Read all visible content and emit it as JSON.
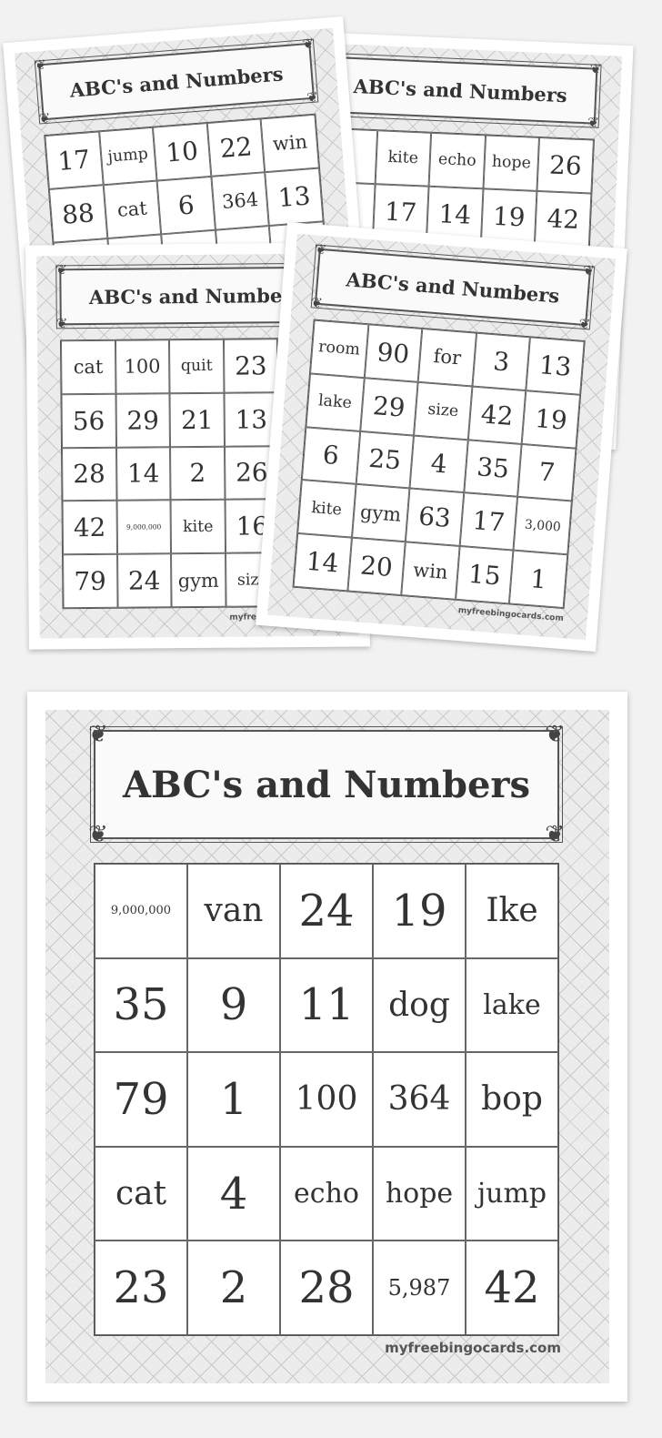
{
  "cards": [
    {
      "id": "card-b",
      "title": "ABC's and Numbers",
      "footer": "myfreebingocards.com",
      "cells": [
        null,
        "kite",
        "echo",
        "hope",
        "26",
        null,
        "17",
        "14",
        "19",
        "42",
        null,
        null,
        null,
        null,
        null,
        null,
        null,
        null,
        null,
        null,
        null,
        null,
        null,
        null,
        null
      ]
    },
    {
      "id": "card-a",
      "title": "ABC's and Numbers",
      "footer": "myfreebingocards.com",
      "cells": [
        "17",
        "jump",
        "10",
        "22",
        "win",
        "88",
        "cat",
        "6",
        "364",
        "13",
        null,
        null,
        null,
        null,
        null,
        null,
        null,
        null,
        null,
        null,
        null,
        null,
        null,
        null,
        null
      ]
    },
    {
      "id": "card-c",
      "title": "ABC's and Numbers",
      "footer": "myfreebingocards.com",
      "cells": [
        "cat",
        "100",
        "quit",
        "23",
        null,
        "56",
        "29",
        "21",
        "13",
        null,
        "28",
        "14",
        "2",
        "26",
        null,
        "42",
        "9,000,000",
        "kite",
        "16",
        null,
        "79",
        "24",
        "gym",
        "size",
        null
      ]
    },
    {
      "id": "card-d",
      "title": "ABC's and Numbers",
      "footer": "myfreebingocards.com",
      "cells": [
        "room",
        "90",
        "for",
        "3",
        "13",
        "lake",
        "29",
        "size",
        "42",
        "19",
        "6",
        "25",
        "4",
        "35",
        "7",
        "kite",
        "gym",
        "63",
        "17",
        "3,000",
        "14",
        "20",
        "win",
        "15",
        "1"
      ]
    }
  ],
  "main_card": {
    "title": "ABC's and Numbers",
    "footer": "myfreebingocards.com",
    "cells": [
      "9,000,000",
      "van",
      "24",
      "19",
      "Ike",
      "35",
      "9",
      "11",
      "dog",
      "lake",
      "79",
      "1",
      "100",
      "364",
      "bop",
      "cat",
      "4",
      "echo",
      "hope",
      "jump",
      "23",
      "2",
      "28",
      "5,987",
      "42"
    ]
  }
}
